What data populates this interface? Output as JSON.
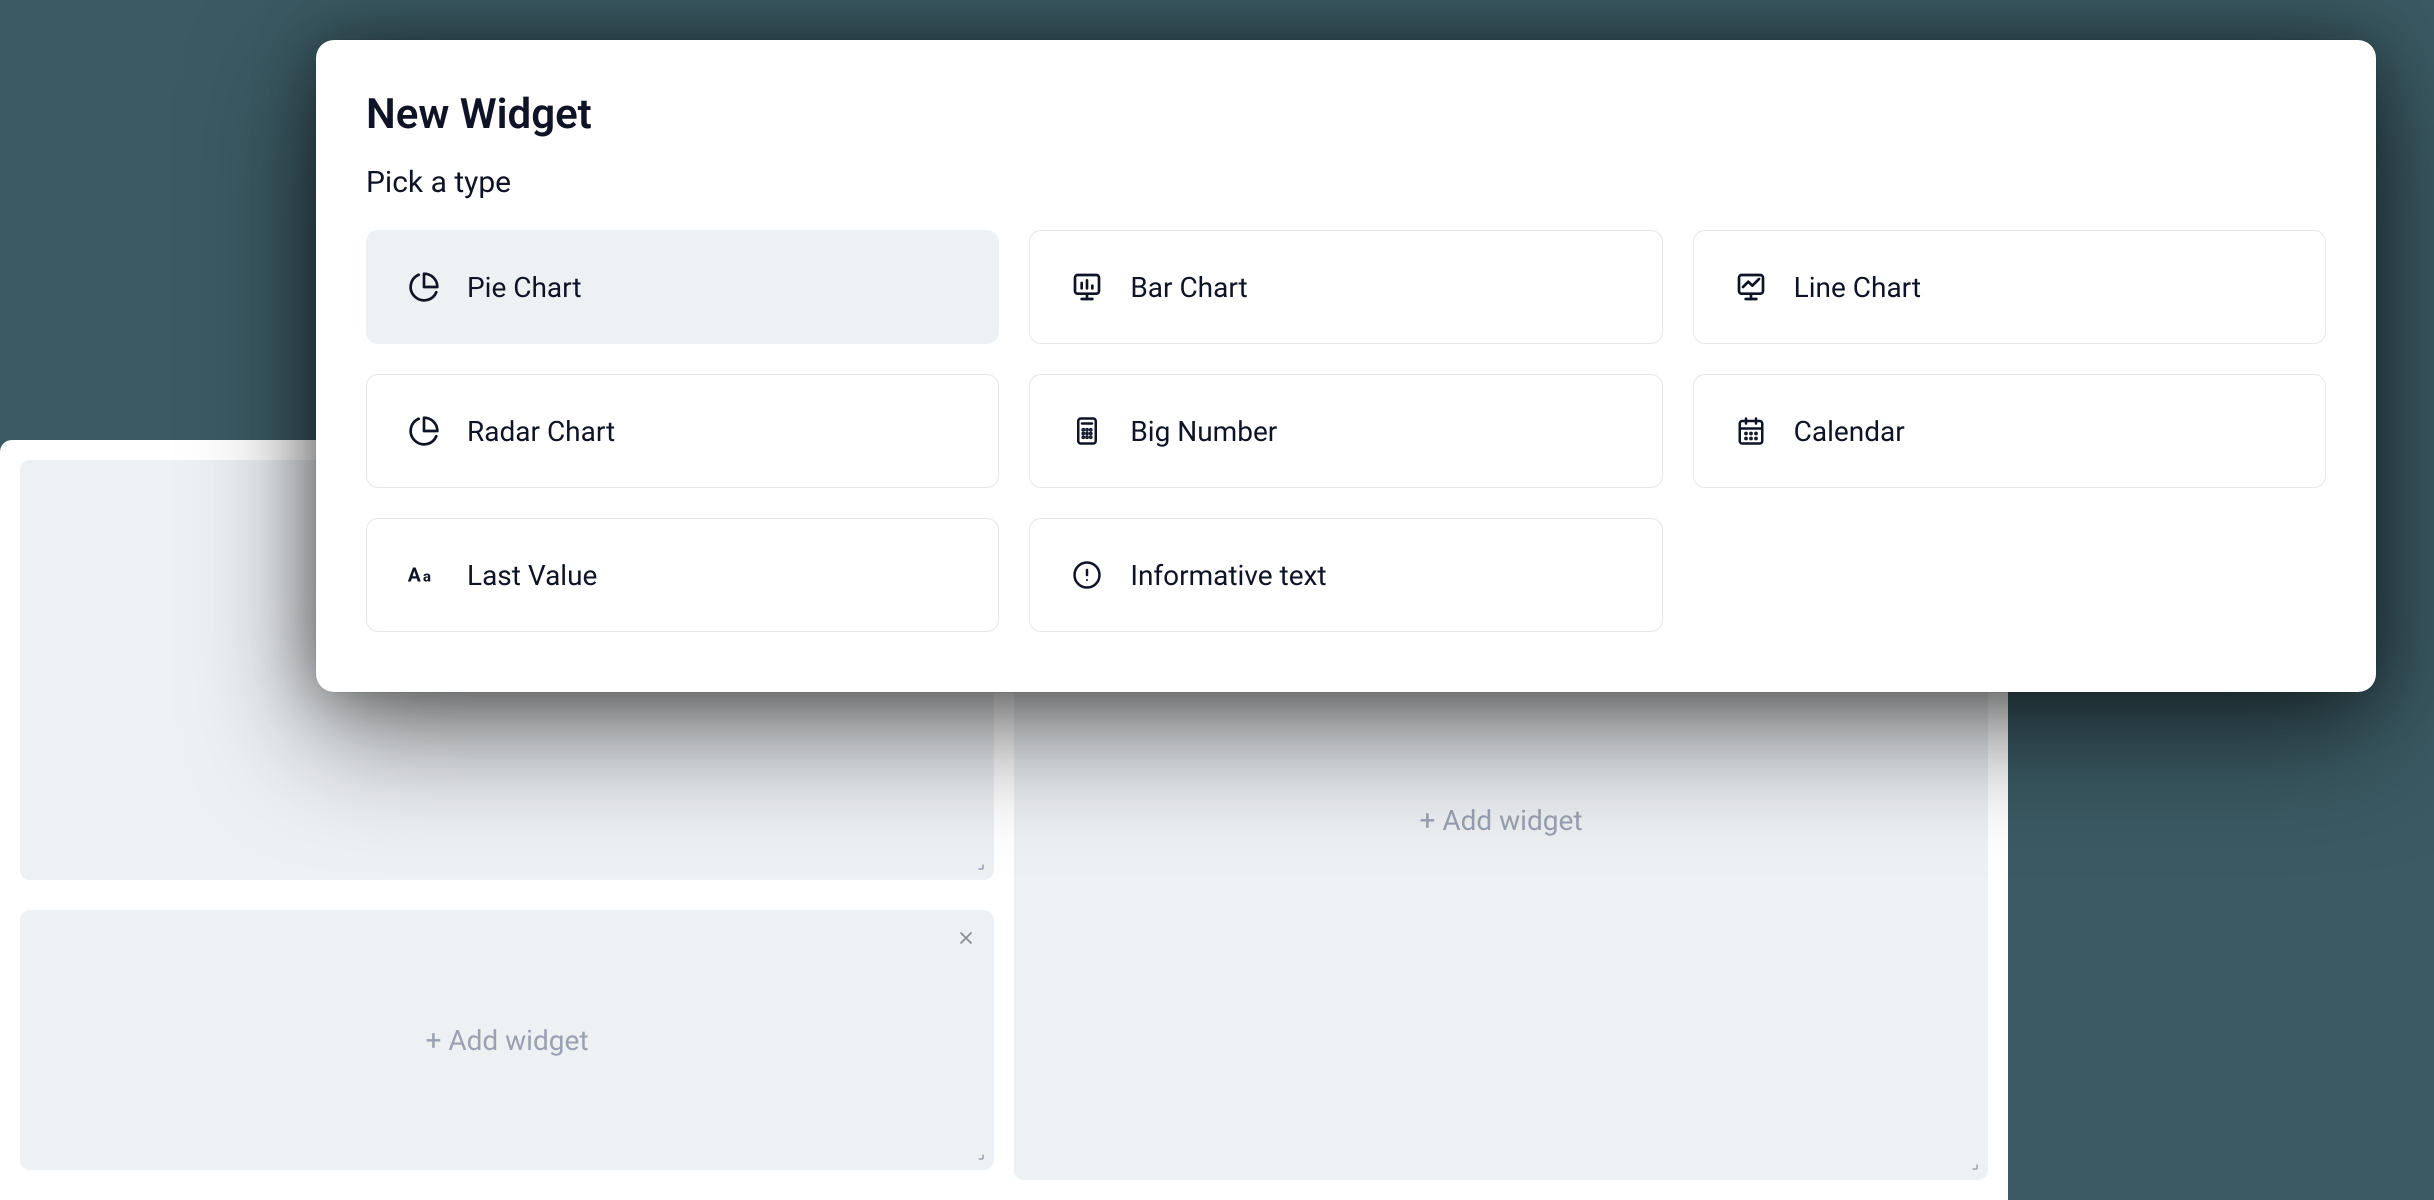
{
  "modal": {
    "title": "New Widget",
    "subtitle": "Pick a type",
    "types": [
      {
        "label": "Pie Chart",
        "icon": "pie-chart-icon",
        "selected": true
      },
      {
        "label": "Bar Chart",
        "icon": "bar-chart-icon",
        "selected": false
      },
      {
        "label": "Line Chart",
        "icon": "line-chart-icon",
        "selected": false
      },
      {
        "label": "Radar Chart",
        "icon": "radar-chart-icon",
        "selected": false
      },
      {
        "label": "Big Number",
        "icon": "calculator-icon",
        "selected": false
      },
      {
        "label": "Calendar",
        "icon": "calendar-icon",
        "selected": false
      },
      {
        "label": "Last Value",
        "icon": "text-aa-icon",
        "selected": false
      },
      {
        "label": "Informative text",
        "icon": "info-icon",
        "selected": false
      }
    ]
  },
  "dashboard": {
    "add_widget_label": "+ Add widget"
  }
}
